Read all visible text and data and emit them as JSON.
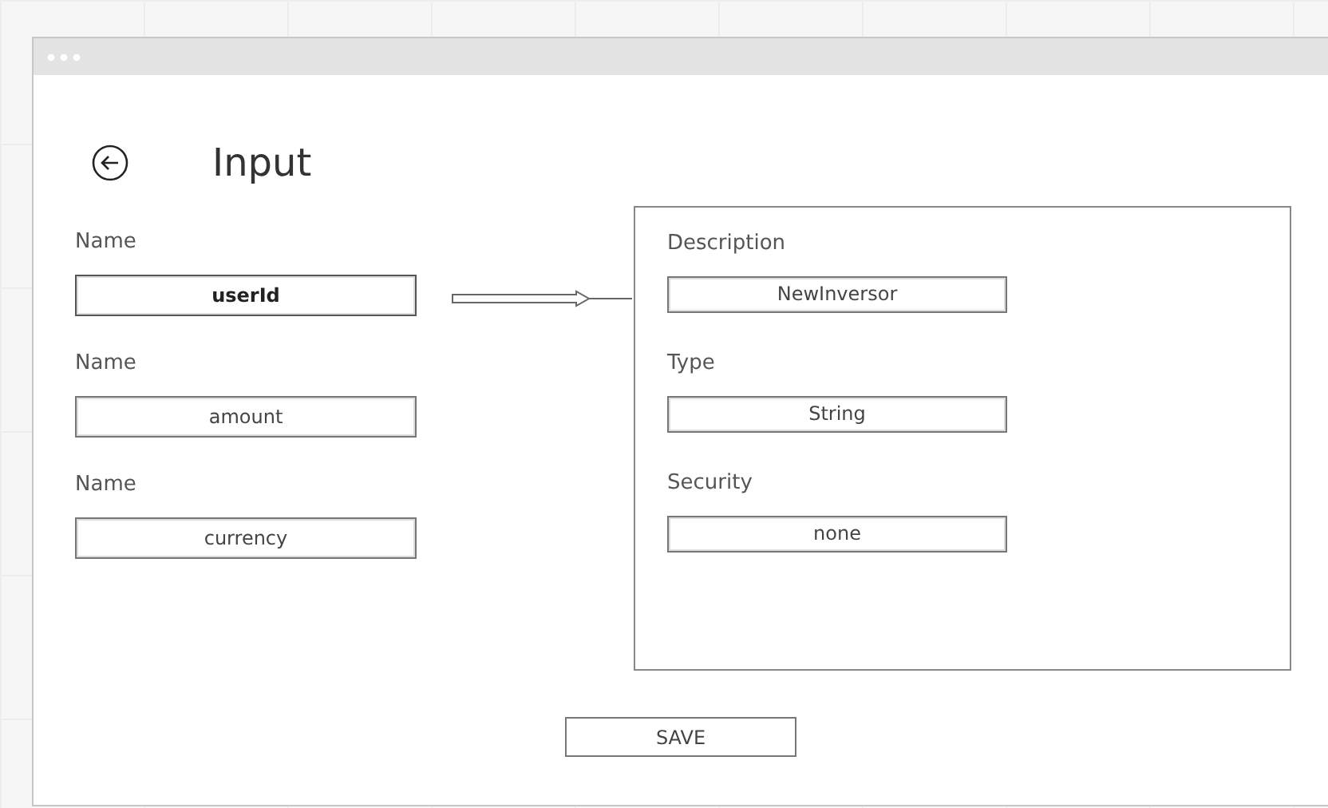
{
  "page": {
    "title": "Input"
  },
  "inputs": [
    {
      "label": "Name",
      "value": "userId",
      "selected": true
    },
    {
      "label": "Name",
      "value": "amount",
      "selected": false
    },
    {
      "label": "Name",
      "value": "currency",
      "selected": false
    }
  ],
  "details": [
    {
      "label": "Description",
      "value": "NewInversor"
    },
    {
      "label": "Type",
      "value": "String"
    },
    {
      "label": "Security",
      "value": "none"
    }
  ],
  "save_button": "SAVE"
}
